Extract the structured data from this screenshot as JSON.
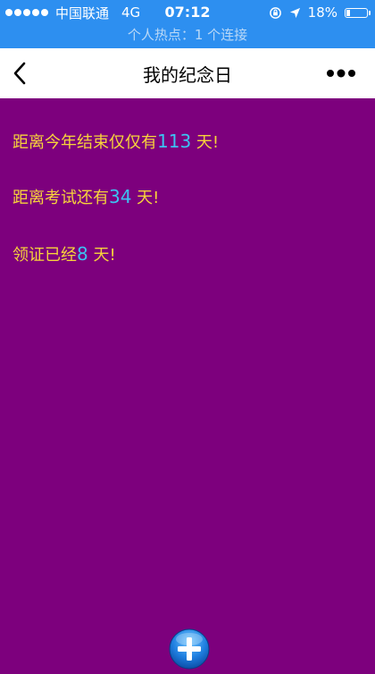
{
  "status_bar": {
    "carrier": "中国联通",
    "network": "4G",
    "time": "07:12",
    "battery_percent": "18%",
    "battery_level": 0.18,
    "hotspot_text": "个人热点：1 个连接"
  },
  "nav": {
    "title": "我的纪念日"
  },
  "items": [
    {
      "prefix": "距离今年结束仅仅有",
      "number": "113",
      "suffix": " 天!"
    },
    {
      "prefix": "距离考试还有",
      "number": "34",
      "suffix": " 天!"
    },
    {
      "prefix": "领证已经",
      "number": "8",
      "suffix": " 天!"
    }
  ],
  "colors": {
    "background": "#7d007d",
    "status_bar": "#2d8ff0",
    "text": "#f7d33b",
    "number": "#3cc3f2"
  },
  "icons": {
    "back": "chevron-left-icon",
    "more": "more-dots-icon",
    "add": "plus-circle-icon"
  }
}
